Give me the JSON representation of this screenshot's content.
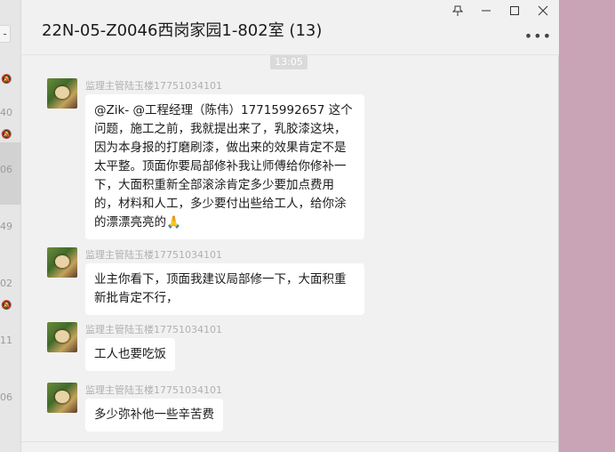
{
  "left_strip": {
    "minus_glyph": "-",
    "numbers": [
      "40",
      "06",
      "49",
      "02",
      "11",
      "06"
    ]
  },
  "window": {
    "title": "22N-05-Z0046西岗家园1-802室 (13)",
    "pin_icon": "pin-icon",
    "min_icon": "minimize-icon",
    "max_icon": "maximize-icon",
    "close_icon": "close-icon",
    "more_label": "•••"
  },
  "chat": {
    "time_separator": "13:05",
    "messages": [
      {
        "sender": "监理主管陆玉楼17751034101",
        "text": "@Zik- @工程经理（陈伟）17715992657 这个问题，施工之前，我就提出来了，乳胶漆这块，因为本身报的打磨刷漆，做出来的效果肯定不是太平整。顶面你要局部修补我让师傅给你修补一下，大面积重新全部滚涂肯定多少要加点费用的，材料和人工，多少要付出些给工人，给你涂的漂漂亮亮的🙏"
      },
      {
        "sender": "监理主管陆玉楼17751034101",
        "text": "业主你看下，顶面我建议局部修一下，大面积重新批肯定不行，"
      },
      {
        "sender": "监理主管陆玉楼17751034101",
        "text": "工人也要吃饭"
      },
      {
        "sender": "监理主管陆玉楼17751034101",
        "text": "多少弥补他一些辛苦费"
      }
    ]
  }
}
